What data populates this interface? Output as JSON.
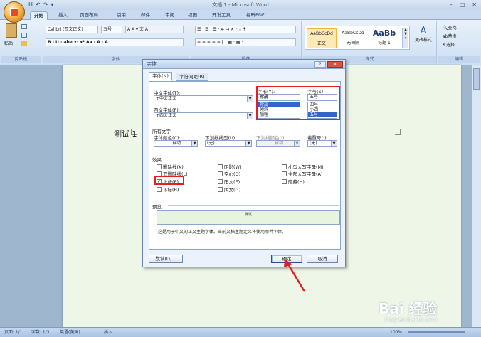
{
  "window": {
    "title": "文档 1 - Microsoft Word",
    "controls": [
      "–",
      "□",
      "✕"
    ]
  },
  "qat": [
    "H",
    "↶",
    "↷",
    "▾"
  ],
  "tabs": [
    "开始",
    "插入",
    "页面布局",
    "引用",
    "邮件",
    "审阅",
    "视图",
    "开发工具",
    "福昕PDF"
  ],
  "ribbon": {
    "clipboard": {
      "label": "剪贴板",
      "paste": "粘贴"
    },
    "font": {
      "label": "字体",
      "font_name": "Calibri (西文正文)",
      "font_size": "五号",
      "row2": "B  I  U · abe  x₂  x²  Aa · A · A"
    },
    "paragraph": {
      "label": "段落"
    },
    "styles": {
      "label": "样式",
      "items": [
        {
          "sample": "AaBbCcDd",
          "name": "正文"
        },
        {
          "sample": "AaBbCcDd",
          "name": "无间隔"
        },
        {
          "sample": "AaBb",
          "name": "标题 1"
        }
      ],
      "change": "更改样式"
    },
    "editing": {
      "label": "编辑",
      "find": "查找",
      "replace": "替换",
      "select": "选择"
    }
  },
  "document": {
    "text": "测试 1"
  },
  "status": {
    "page": "页面: 1/1",
    "words": "字数: 1/3",
    "lang": "英语(美国)",
    "insert": "插入",
    "zoom": "100%"
  },
  "watermark": {
    "brand": "Bai 经验",
    "url": "jingyan.baidu.com"
  },
  "dialog": {
    "title": "字体",
    "tabs": [
      "字体(N)",
      "字符间距(R)"
    ],
    "cn_font_label": "中文字体(T):",
    "cn_font": "+中文正文",
    "west_font_label": "西文字体(F):",
    "west_font": "+西文正文",
    "style_label": "字形(Y):",
    "style_value": "常规",
    "style_list": [
      "常规",
      "倾斜",
      "加粗"
    ],
    "size_label": "字号(S):",
    "size_value": "五号",
    "size_list": [
      "四号",
      "小四",
      "五号"
    ],
    "all_text": "所有文字",
    "color_label": "字体颜色(C):",
    "color": "自动",
    "underline_label": "下划线线型(U):",
    "underline": "(无)",
    "uline_color_label": "下划线颜色(I):",
    "uline_color": "自动",
    "emphasis_label": "着重号(·):",
    "emphasis": "(无)",
    "effects_label": "效果",
    "effects": [
      {
        "label": "删除线(K)",
        "checked": false
      },
      {
        "label": "双删除线(L)",
        "checked": false
      },
      {
        "label": "上标(P)",
        "checked": true
      },
      {
        "label": "下标(B)",
        "checked": false
      },
      {
        "label": "阴影(W)",
        "checked": false
      },
      {
        "label": "空心(O)",
        "checked": false
      },
      {
        "label": "阳文(E)",
        "checked": false
      },
      {
        "label": "阴文(G)",
        "checked": false
      },
      {
        "label": "小型大写字母(M)",
        "checked": false
      },
      {
        "label": "全部大写字母(A)",
        "checked": false
      },
      {
        "label": "隐藏(H)",
        "checked": false
      }
    ],
    "preview_label": "预览",
    "preview_text": "测试",
    "note": "这是用于中文的正文主题字体。当前文档主题定义将使用哪种字体。",
    "default_btn": "默认(D)...",
    "ok_btn": "确定",
    "cancel_btn": "取消"
  }
}
